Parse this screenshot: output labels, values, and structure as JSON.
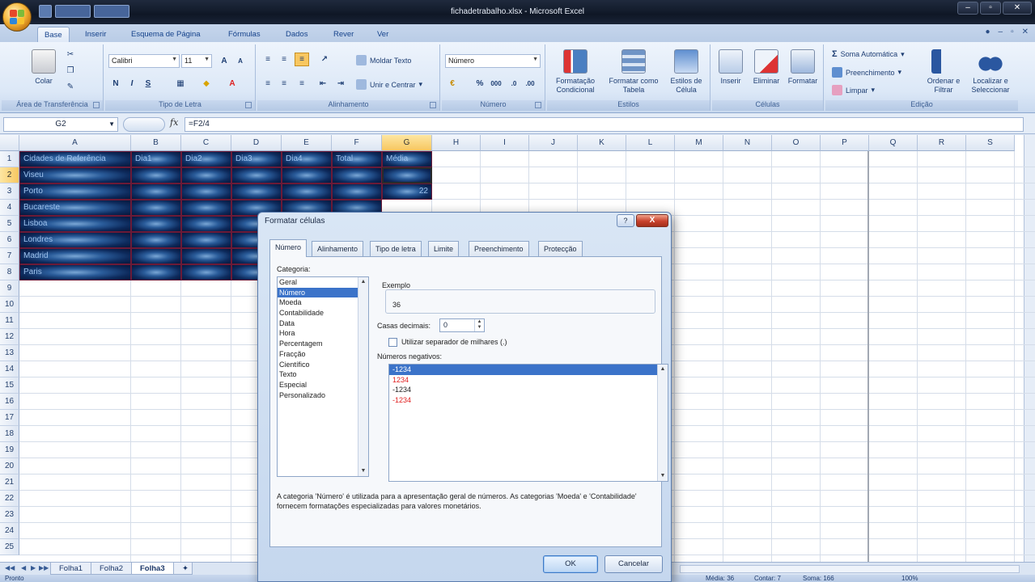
{
  "window": {
    "title": "fichadetrabalho.xlsx - Microsoft Excel"
  },
  "ribbon_tabs": [
    "Base",
    "Inserir",
    "Esquema de Página",
    "Fórmulas",
    "Dados",
    "Rever",
    "Ver"
  ],
  "ribbon": {
    "clipboard": {
      "paste": "Colar",
      "label": "Área de Transferência"
    },
    "font": {
      "name": "Calibri",
      "size": "11",
      "label": "Tipo de Letra"
    },
    "alignment": {
      "wrap": "Moldar Texto",
      "merge": "Unir e Centrar",
      "label": "Alinhamento"
    },
    "number": {
      "format": "Número",
      "label": "Número"
    },
    "styles": {
      "conditional": "Formatação Condicional",
      "as_table": "Formatar como Tabela",
      "cell_styles": "Estilos de Célula",
      "label": "Estilos"
    },
    "cells": {
      "insert": "Inserir",
      "delete": "Eliminar",
      "format": "Formatar",
      "label": "Células"
    },
    "editing": {
      "autosum": "Soma Automática",
      "fill": "Preenchimento",
      "clear": "Limpar",
      "sort": "Ordenar e Filtrar",
      "find": "Localizar e Seleccionar",
      "label": "Edição"
    }
  },
  "formula_bar": {
    "cell_ref": "G2",
    "formula": "=F2/4"
  },
  "grid": {
    "columns": [
      "A",
      "B",
      "C",
      "D",
      "E",
      "F",
      "G",
      "H",
      "I",
      "J",
      "K",
      "L",
      "M",
      "N",
      "O",
      "P",
      "Q",
      "R",
      "S"
    ],
    "rows": [
      "1",
      "2",
      "3",
      "4",
      "5",
      "6",
      "7",
      "8",
      "9",
      "10",
      "11",
      "12",
      "13",
      "14",
      "15",
      "16",
      "17",
      "18",
      "19",
      "20",
      "21",
      "22",
      "23",
      "24",
      "25"
    ],
    "header_row": [
      "Cidades de Referência",
      "Dia1",
      "Dia2",
      "Dia3",
      "Dia4",
      "Total",
      "Média"
    ],
    "row_labels": [
      "Viseu",
      "Porto",
      "Bucareste",
      "Lisboa",
      "Londres",
      "Madrid",
      "Paris"
    ],
    "g3_value": "22"
  },
  "sheets": [
    "Folha1",
    "Folha2",
    "Folha3"
  ],
  "status": {
    "ready": "Pronto",
    "average": "Média: 36",
    "count": "Contar: 7",
    "sum": "Soma: 166",
    "zoom": "100%"
  },
  "dialog": {
    "title": "Formatar células",
    "tabs": [
      "Número",
      "Alinhamento",
      "Tipo de letra",
      "Limite",
      "Preenchimento",
      "Protecção"
    ],
    "category_label": "Categoria:",
    "categories": [
      "Geral",
      "Número",
      "Moeda",
      "Contabilidade",
      "Data",
      "Hora",
      "Percentagem",
      "Fracção",
      "Científico",
      "Texto",
      "Especial",
      "Personalizado"
    ],
    "selected_category": "Número",
    "example_label": "Exemplo",
    "example_value": "36",
    "decimals_label": "Casas decimais:",
    "decimals_value": "0",
    "thousands_label": "Utilizar separador de milhares (.)",
    "negative_label": "Números negativos:",
    "negative_options": [
      "-1234",
      "1234",
      "-1234",
      "-1234"
    ],
    "description": "A categoria 'Número' é utilizada para a apresentação geral de números. As categorias 'Moeda' e 'Contabilidade' fornecem formatações especializadas para valores monetários.",
    "ok": "OK",
    "cancel": "Cancelar",
    "help": "?",
    "close": "X"
  }
}
